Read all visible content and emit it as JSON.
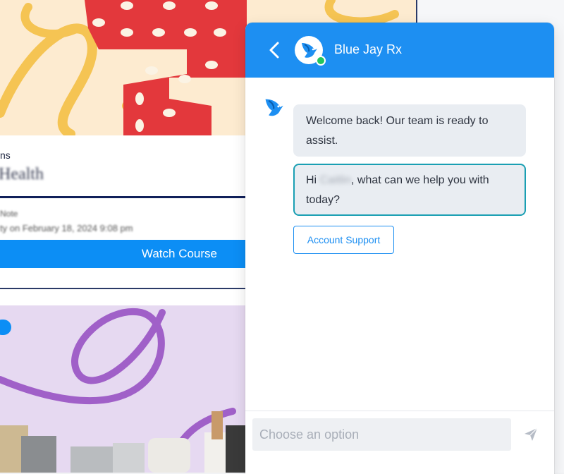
{
  "background_course": {
    "category_text": "ns",
    "title_text": "Health",
    "line1_text": "Note",
    "line2_text": "ty on February 18, 2024 9:08 pm",
    "watch_button_label": "Watch Course"
  },
  "chat": {
    "header_title": "Blue Jay Rx",
    "messages": [
      {
        "text": "Welcome back! Our team is ready to assist."
      },
      {
        "prefix": "Hi ",
        "name": "Caitlin",
        "suffix": ", what can we help you with today?"
      }
    ],
    "option_label": "Account Support",
    "input_placeholder": "Choose an option"
  },
  "colors": {
    "header_bg": "#1d8ff2",
    "accent": "#1d8ff2",
    "online_status": "#22c55e",
    "focused_bubble_border": "#1a9fb3",
    "bubble_bg": "#e9edf2"
  },
  "icons": {
    "back": "chevron-left-icon",
    "brand": "blue-jay-bird-logo",
    "send": "paper-plane-icon"
  }
}
